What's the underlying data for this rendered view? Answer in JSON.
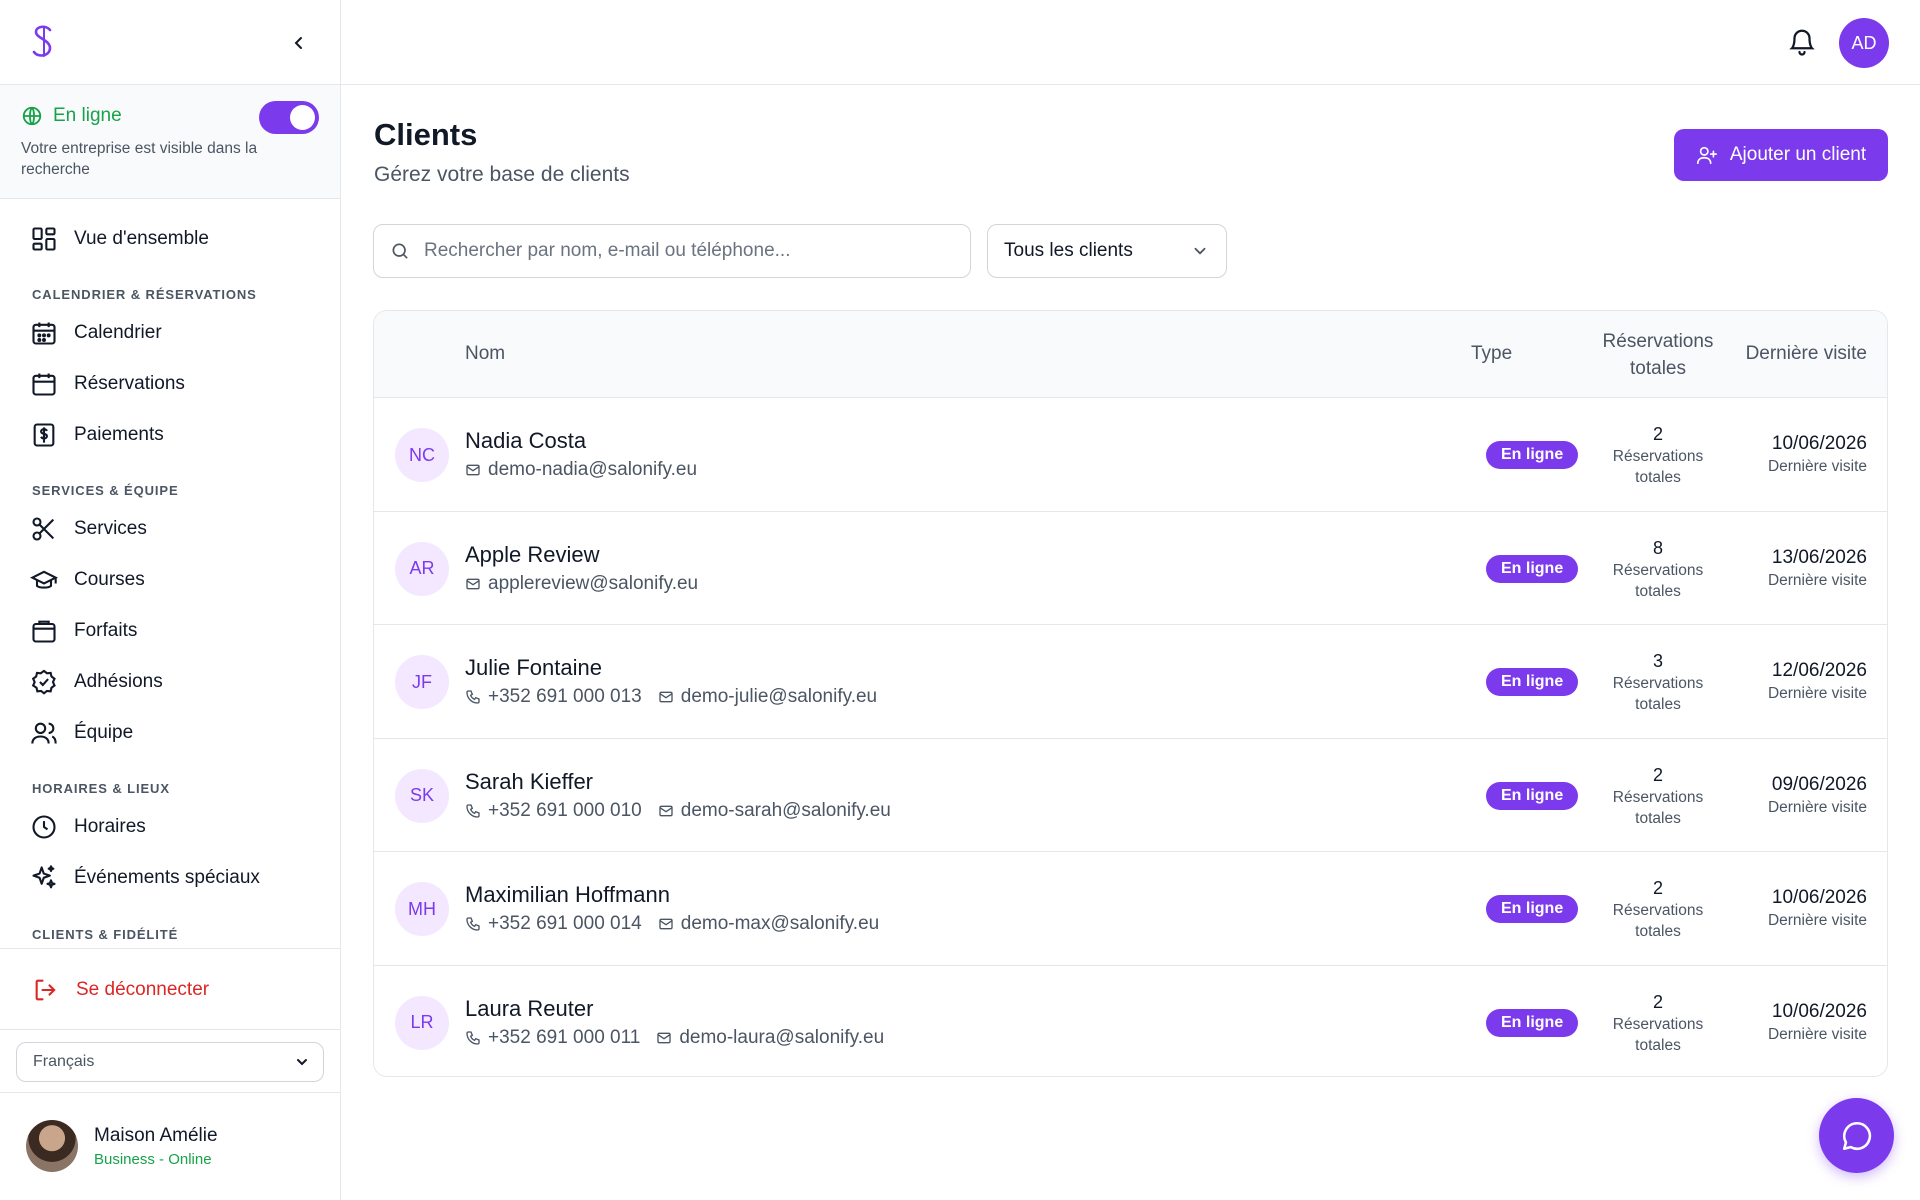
{
  "sidebar": {
    "online": {
      "label": "En ligne",
      "description": "Votre entreprise est visible dans la recherche",
      "toggle_on": true
    },
    "overview": "Vue d'ensemble",
    "sections": {
      "calendar": "CALENDRIER & RÉSERVATIONS",
      "services": "SERVICES & ÉQUIPE",
      "hours": "HORAIRES & LIEUX",
      "clients": "CLIENTS & FIDÉLITÉ"
    },
    "items": {
      "calendar": "Calendrier",
      "reservations": "Réservations",
      "payments": "Paiements",
      "services": "Services",
      "courses": "Courses",
      "packages": "Forfaits",
      "memberships": "Adhésions",
      "team": "Équipe",
      "hours": "Horaires",
      "events": "Événements spéciaux"
    },
    "logout": "Se déconnecter",
    "language": "Français",
    "profile": {
      "name": "Maison Amélie",
      "subtitle": "Business - Online"
    }
  },
  "topbar": {
    "user_initials": "AD"
  },
  "main": {
    "title": "Clients",
    "subtitle": "Gérez votre base de clients",
    "add_button": "Ajouter un client",
    "search_placeholder": "Rechercher par nom, e-mail ou téléphone...",
    "filter": "Tous les clients"
  },
  "table": {
    "headers": {
      "name": "Nom",
      "type": "Type",
      "reservations": "Réservations totales",
      "last_visit": "Dernière visite"
    },
    "rows": [
      {
        "initials": "NC",
        "name": "Nadia Costa",
        "phone": "",
        "email": "demo-nadia@salonify.eu",
        "type": "En ligne",
        "reservations": "2",
        "reservations_label": "Réservations totales",
        "last_visit": "10/06/2026",
        "last_visit_label": "Dernière visite"
      },
      {
        "initials": "AR",
        "name": "Apple Review",
        "phone": "",
        "email": "applereview@salonify.eu",
        "type": "En ligne",
        "reservations": "8",
        "reservations_label": "Réservations totales",
        "last_visit": "13/06/2026",
        "last_visit_label": "Dernière visite"
      },
      {
        "initials": "JF",
        "name": "Julie Fontaine",
        "phone": "+352 691 000 013",
        "email": "demo-julie@salonify.eu",
        "type": "En ligne",
        "reservations": "3",
        "reservations_label": "Réservations totales",
        "last_visit": "12/06/2026",
        "last_visit_label": "Dernière visite"
      },
      {
        "initials": "SK",
        "name": "Sarah Kieffer",
        "phone": "+352 691 000 010",
        "email": "demo-sarah@salonify.eu",
        "type": "En ligne",
        "reservations": "2",
        "reservations_label": "Réservations totales",
        "last_visit": "09/06/2026",
        "last_visit_label": "Dernière visite"
      },
      {
        "initials": "MH",
        "name": "Maximilian Hoffmann",
        "phone": "+352 691 000 014",
        "email": "demo-max@salonify.eu",
        "type": "En ligne",
        "reservations": "2",
        "reservations_label": "Réservations totales",
        "last_visit": "10/06/2026",
        "last_visit_label": "Dernière visite"
      },
      {
        "initials": "LR",
        "name": "Laura Reuter",
        "phone": "+352 691 000 011",
        "email": "demo-laura@salonify.eu",
        "type": "En ligne",
        "reservations": "2",
        "reservations_label": "Réservations totales",
        "last_visit": "10/06/2026",
        "last_visit_label": "Dernière visite"
      }
    ]
  },
  "colors": {
    "accent": "#7c3aed",
    "online_green": "#16a34a",
    "logout_red": "#dc2626"
  },
  "icons": [
    "logo-icon",
    "chevron-left-icon",
    "globe-icon",
    "grid-icon",
    "calendar-grid-icon",
    "calendar-icon",
    "dollar-icon",
    "scissors-icon",
    "graduation-cap-icon",
    "package-icon",
    "check-badge-icon",
    "users-icon",
    "clock-icon",
    "sparkles-icon",
    "logout-icon",
    "chevron-down-icon",
    "bell-icon",
    "user-plus-icon",
    "search-icon",
    "phone-icon",
    "mail-icon",
    "chat-icon"
  ]
}
